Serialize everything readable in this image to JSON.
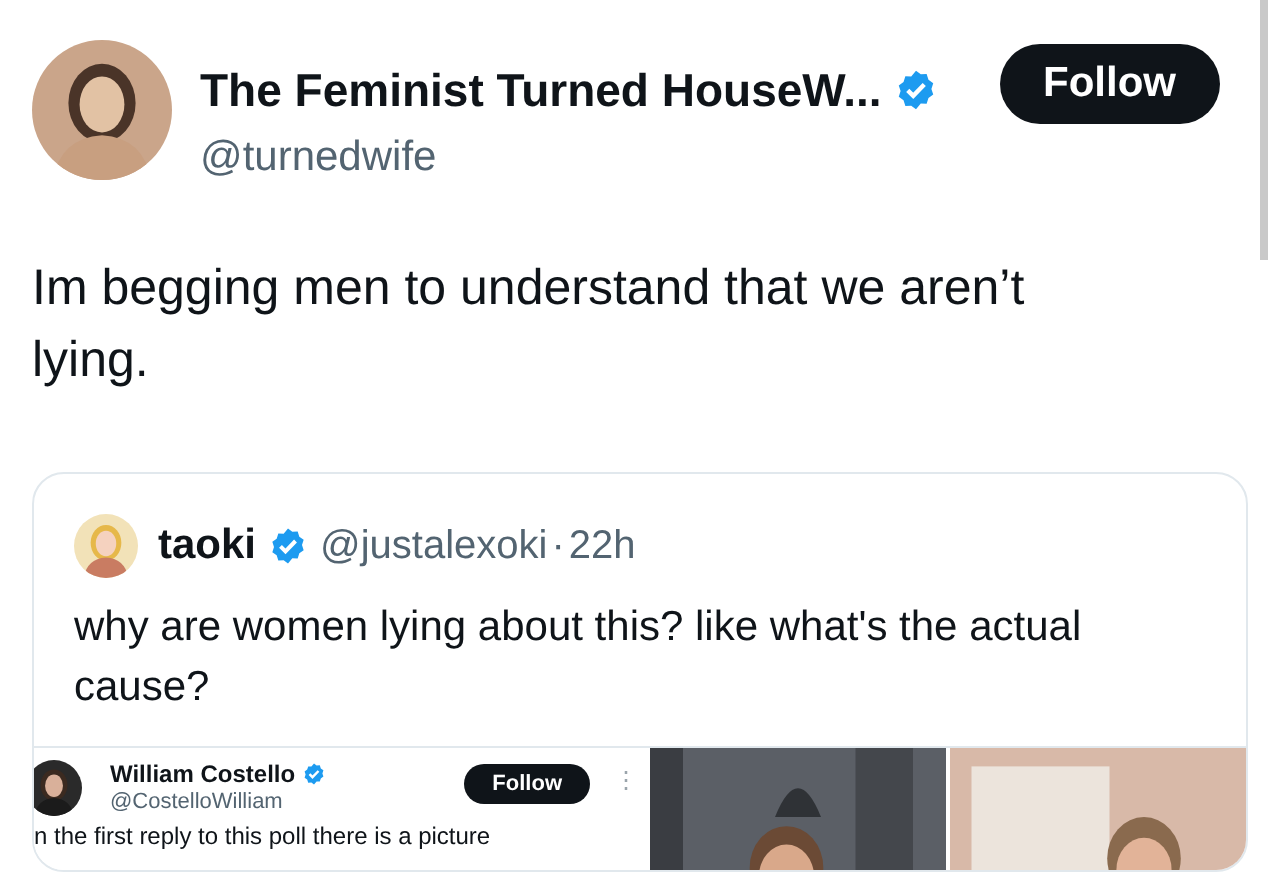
{
  "author": {
    "name": "The Feminist Turned HouseW...",
    "handle": "@turnedwife",
    "verified": true
  },
  "follow_button": "Follow",
  "text": "Im begging men to understand that we aren’t lying.",
  "quote": {
    "name": "taoki",
    "verified": true,
    "handle": "@justalexoki",
    "separator": "·",
    "time": "22h",
    "text": "why are women lying about this? like what's the actual cause?",
    "media": {
      "screenshot": {
        "name": "William Costello",
        "verified": true,
        "handle": "@CostelloWilliam",
        "follow_button": "Follow",
        "menu": "⋮",
        "text": "n the first reply to this poll there is a picture"
      }
    }
  }
}
